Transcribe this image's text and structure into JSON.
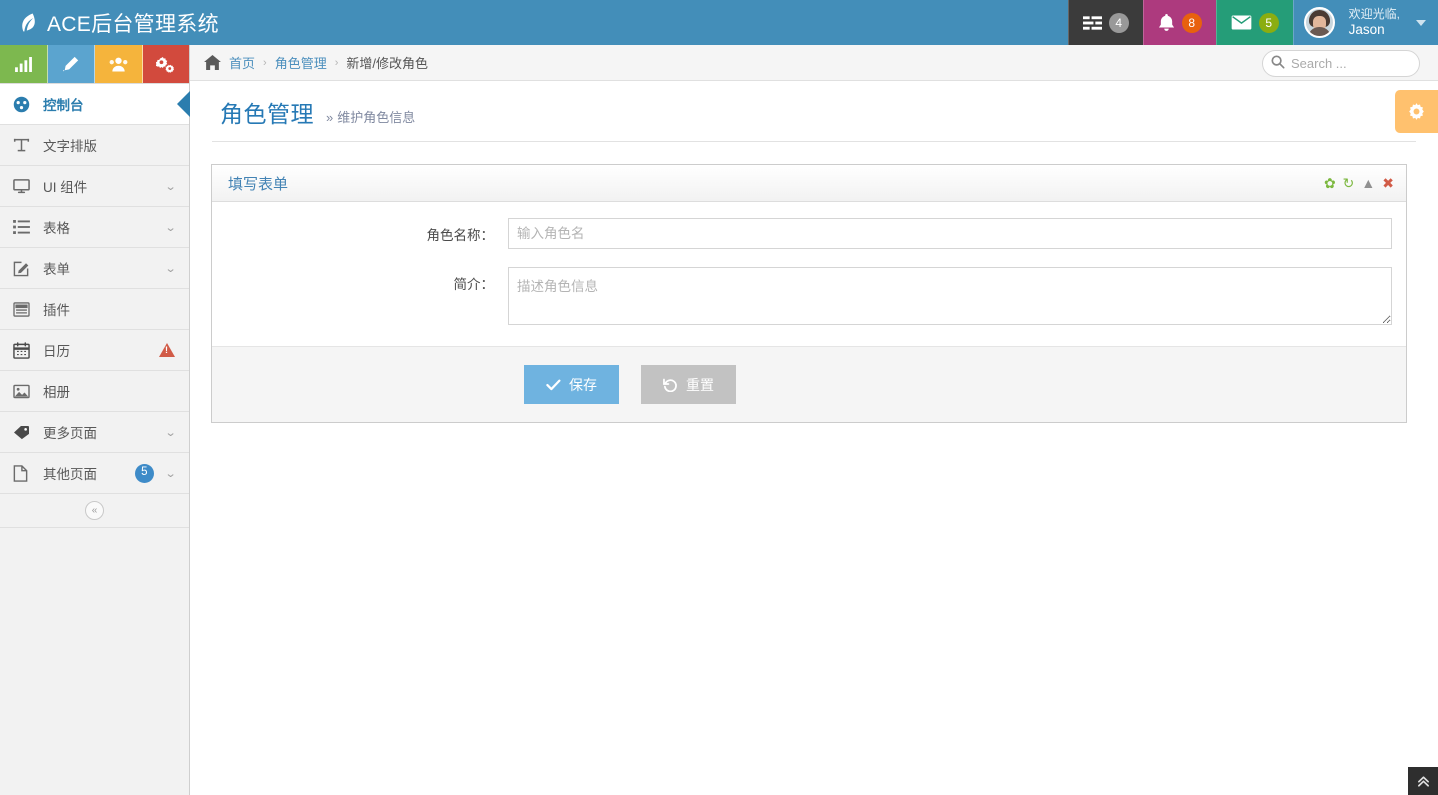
{
  "navbar": {
    "brand": "ACE后台管理系统",
    "brand_icon": "leaf-icon",
    "tasks": {
      "icon": "tasks-list-icon",
      "badge": "4"
    },
    "alerts": {
      "icon": "bell-icon",
      "badge": "8"
    },
    "messages": {
      "icon": "envelope-icon",
      "badge": "5"
    },
    "user": {
      "welcome": "欢迎光临,",
      "name": "Jason",
      "avatar": "user-avatar",
      "caret": "caret-down-icon"
    },
    "colors": {
      "brand_bg": "#438EB9",
      "tasks_bg": "#3B3B3B",
      "alerts_bg": "#AD3A7E",
      "messages_bg": "#259D78",
      "badge_grey": "#999999",
      "badge_orange": "#E8610E",
      "badge_green": "#8BAD10"
    }
  },
  "sidebar": {
    "shortcuts": [
      {
        "name": "shortcut-chart",
        "icon": "bar-chart-icon",
        "color": "#7DB84F"
      },
      {
        "name": "shortcut-edit",
        "icon": "pencil-icon",
        "color": "#5BA4CF"
      },
      {
        "name": "shortcut-users",
        "icon": "group-icon",
        "color": "#F5B43C"
      },
      {
        "name": "shortcut-settings",
        "icon": "cogs-icon",
        "color": "#D24A3D"
      }
    ],
    "items": [
      {
        "label": "控制台",
        "icon": "dashboard-icon",
        "active": true,
        "caret": false
      },
      {
        "label": "文字排版",
        "icon": "typography-icon",
        "active": false,
        "caret": false
      },
      {
        "label": "UI 组件",
        "icon": "desktop-icon",
        "active": false,
        "caret": true
      },
      {
        "label": "表格",
        "icon": "table-list-icon",
        "active": false,
        "caret": true
      },
      {
        "label": "表单",
        "icon": "form-edit-icon",
        "active": false,
        "caret": true
      },
      {
        "label": "插件",
        "icon": "widget-icon",
        "active": false,
        "caret": false
      },
      {
        "label": "日历",
        "icon": "calendar-icon",
        "active": false,
        "caret": false,
        "warning": true
      },
      {
        "label": "相册",
        "icon": "picture-icon",
        "active": false,
        "caret": false
      },
      {
        "label": "更多页面",
        "icon": "tag-icon",
        "active": false,
        "caret": true
      },
      {
        "label": "其他页面",
        "icon": "file-icon",
        "active": false,
        "caret": true,
        "badge": "5"
      }
    ],
    "collapse_icon": "double-chevron-left-icon"
  },
  "breadcrumb": {
    "home_icon": "home-icon",
    "items": [
      {
        "label": "首页",
        "link": true
      },
      {
        "label": "角色管理",
        "link": true
      },
      {
        "label": "新增/修改角色",
        "link": false
      }
    ],
    "separator": "›"
  },
  "search": {
    "placeholder": "Search ...",
    "value": "",
    "icon": "search-icon"
  },
  "page": {
    "title": "角色管理",
    "subtitle": "维护角色信息",
    "subtitle_arrows": "»"
  },
  "widget": {
    "title": "填写表单",
    "tools": [
      {
        "name": "widget-settings-icon",
        "glyph": "✿",
        "color": "#7CB83F"
      },
      {
        "name": "widget-refresh-icon",
        "glyph": "↻",
        "color": "#7CB83F"
      },
      {
        "name": "widget-collapse-icon",
        "glyph": "▲",
        "color": "#909090"
      },
      {
        "name": "widget-close-icon",
        "glyph": "✖",
        "color": "#D15B47"
      }
    ]
  },
  "form": {
    "fields": [
      {
        "label": "角色名称：",
        "placeholder": "输入角色名",
        "value": "",
        "type": "text"
      },
      {
        "label": "简介：",
        "placeholder": "描述角色信息",
        "value": "",
        "type": "textarea"
      }
    ],
    "buttons": {
      "save": {
        "label": "保存",
        "icon": "check-icon",
        "color": "#6FB3E0"
      },
      "reset": {
        "label": "重置",
        "icon": "undo-icon",
        "color": "#C2C2C2"
      }
    }
  },
  "floating": {
    "settings_tab_icon": "gear-icon",
    "scroll_top_icon": "double-chevron-up-icon"
  }
}
